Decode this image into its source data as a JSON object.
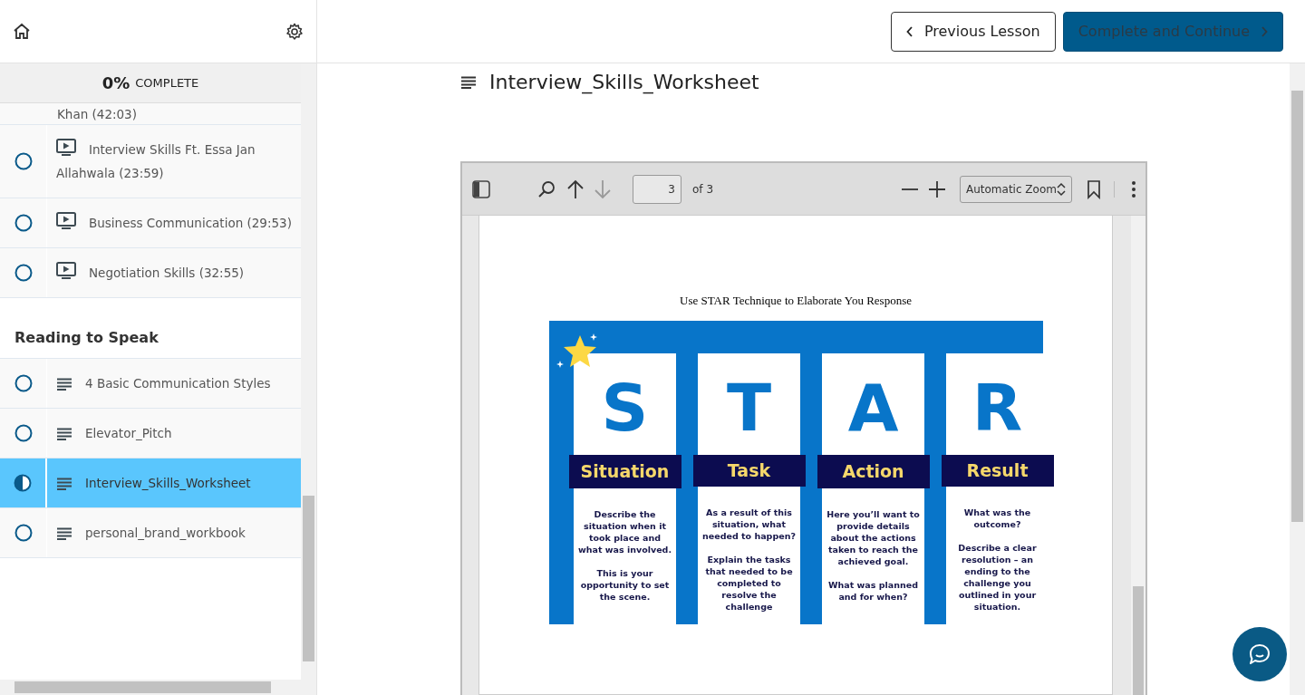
{
  "top_bar": {
    "previous_button": "Previous Lesson",
    "complete_button": "Complete and Continue"
  },
  "progress": {
    "percent": "0%",
    "label": "COMPLETE"
  },
  "sections": [
    {
      "lectures": [
        {
          "kind": "cut_off",
          "title": "Khan (42:03)",
          "selected": false
        },
        {
          "kind": "video",
          "title": "Interview Skills Ft. Essa Jan Allahwala (23:59)",
          "in_progress": false,
          "selected": false
        },
        {
          "kind": "video",
          "title": "Business Communication (29:53)",
          "in_progress": false,
          "selected": false
        },
        {
          "kind": "video",
          "title": "Negotiation Skills (32:55)",
          "in_progress": false,
          "selected": false
        }
      ]
    },
    {
      "title": "Reading to Speak",
      "lectures": [
        {
          "kind": "text",
          "title": "4 Basic Communication Styles",
          "in_progress": false,
          "selected": false
        },
        {
          "kind": "text",
          "title": "Elevator_Pitch",
          "in_progress": false,
          "selected": false
        },
        {
          "kind": "text",
          "title": "Interview_Skills_Worksheet",
          "in_progress": true,
          "selected": true
        },
        {
          "kind": "text",
          "title": "personal_brand_workbook",
          "in_progress": false,
          "selected": false
        }
      ]
    }
  ],
  "lesson_title": "Interview_Skills_Worksheet",
  "pdf_viewer": {
    "page": "3",
    "page_count": "of 3",
    "zoom": "Automatic Zoom"
  },
  "pdf_page": {
    "heading": "Use STAR Technique to Elaborate You Response",
    "columns": [
      {
        "letter": "S",
        "label": "Situation",
        "paragraphs": [
          "Describe the situation when it took place and what was involved.",
          "This is your opportunity to set the scene."
        ]
      },
      {
        "letter": "T",
        "label": "Task",
        "paragraphs": [
          "As a result of this situation, what needed to happen?",
          "Explain the tasks that needed to be completed to resolve the challenge"
        ]
      },
      {
        "letter": "A",
        "label": "Action",
        "paragraphs": [
          "Here you’ll want to provide details about the actions taken to reach the achieved goal.",
          "What was planned and for when?"
        ]
      },
      {
        "letter": "R",
        "label": "Result",
        "paragraphs": [
          "What was the outcome?",
          "Describe a clear resolution – an ending to the challenge you outlined in your situation."
        ]
      }
    ]
  }
}
